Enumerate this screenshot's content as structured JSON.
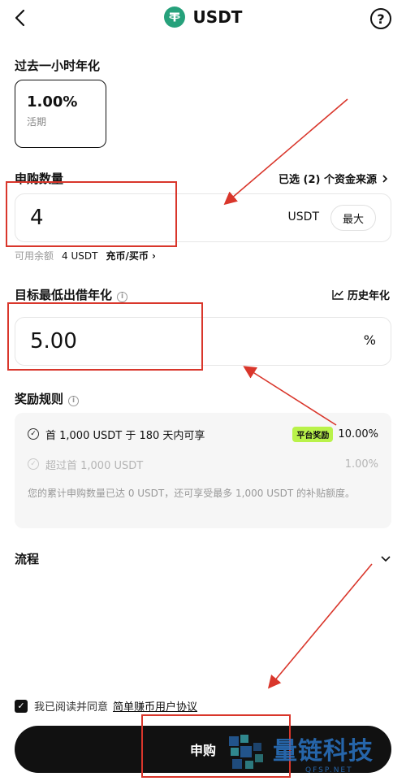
{
  "header": {
    "title": "USDT"
  },
  "apy_section": {
    "label": "过去一小时年化",
    "rate": "1.00%",
    "type": "活期"
  },
  "amount_section": {
    "label": "申购数量",
    "source_link": "已选 (2) 个资金来源",
    "value": "4",
    "unit": "USDT",
    "max_label": "最大",
    "available_label": "可用余额",
    "available_value": "4 USDT",
    "topup_link": "充币/买币"
  },
  "target_section": {
    "label": "目标最低出借年化",
    "history_link": "历史年化",
    "value": "5.00",
    "unit": "%"
  },
  "rules": {
    "label": "奖励规则",
    "row1_text": "首 1,000 USDT 于 180 天内可享",
    "row1_badge": "平台奖励",
    "row1_rate": "10.00%",
    "row2_text": "超过首 1,000 USDT",
    "row2_rate": "1.00%",
    "note": "您的累计申购数量已达 0 USDT，还可享受最多 1,000 USDT 的补贴额度。"
  },
  "flow": {
    "label": "流程"
  },
  "agreement": {
    "text": "我已阅读并同意",
    "link": "简单赚币用户协议"
  },
  "submit_label": "申购",
  "watermark": {
    "cn": "量链科技",
    "en": "QFSP.NET"
  },
  "colors": {
    "accent": "#111111",
    "tether": "#26a17b",
    "promo": "#b9f24a",
    "annotation": "#d9362b",
    "watermark": "#2a74c4"
  }
}
